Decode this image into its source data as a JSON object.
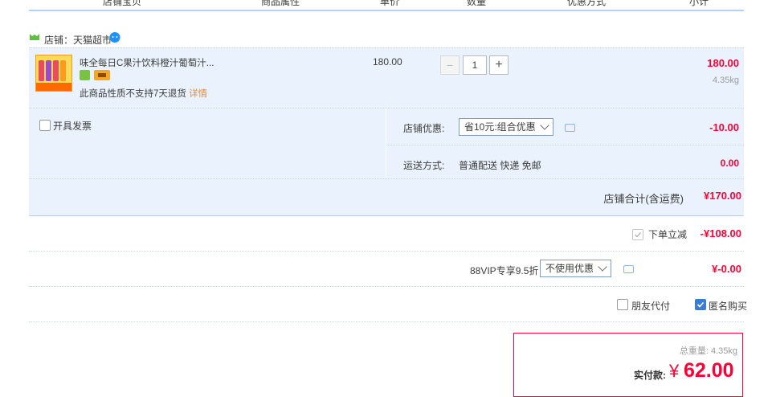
{
  "header": {
    "columns": [
      "店铺宝贝",
      "商品属性",
      "单价",
      "数量",
      "优惠方式",
      "小计"
    ]
  },
  "shop": {
    "label": "店铺：天猫超市"
  },
  "item": {
    "title": "味全每日C果汁饮料橙汁葡萄汁...",
    "return_notice": "此商品性质不支持7天退货",
    "detail_link": "详情",
    "unit_price": "180.00",
    "quantity": "1",
    "minus": "−",
    "plus": "+",
    "subtotal": "180.00",
    "weight": "4.35kg"
  },
  "invoice": {
    "label": "开具发票"
  },
  "shop_discount": {
    "label": "店铺优惠:",
    "selected": "省10元:组合优惠",
    "amount": "-10.00"
  },
  "shipping": {
    "label": "运送方式:",
    "value": "普通配送 快递 免邮",
    "amount": "0.00"
  },
  "shop_total": {
    "label": "店铺合计(含运费)",
    "amount": "¥170.00"
  },
  "order_discount": {
    "label": "下单立减",
    "amount": "-¥108.00",
    "checked": true
  },
  "vip": {
    "label": "88VIP专享9.5折",
    "selected": "不使用优惠",
    "amount": "¥-0.00"
  },
  "options": {
    "friend_pay": "朋友代付",
    "anonymous": "匿名购买",
    "anonymous_checked": true
  },
  "summary": {
    "weight_label": "总重量:",
    "weight": "4.35kg",
    "pay_label": "实付款:",
    "currency": "¥",
    "pay_amount": "62.00"
  },
  "colors": {
    "accent_red": "#ff0036",
    "panel_blue": "#eaf3fd",
    "header_line": "#b2d1ff",
    "checkbox_blue": "#3a7bd5"
  }
}
